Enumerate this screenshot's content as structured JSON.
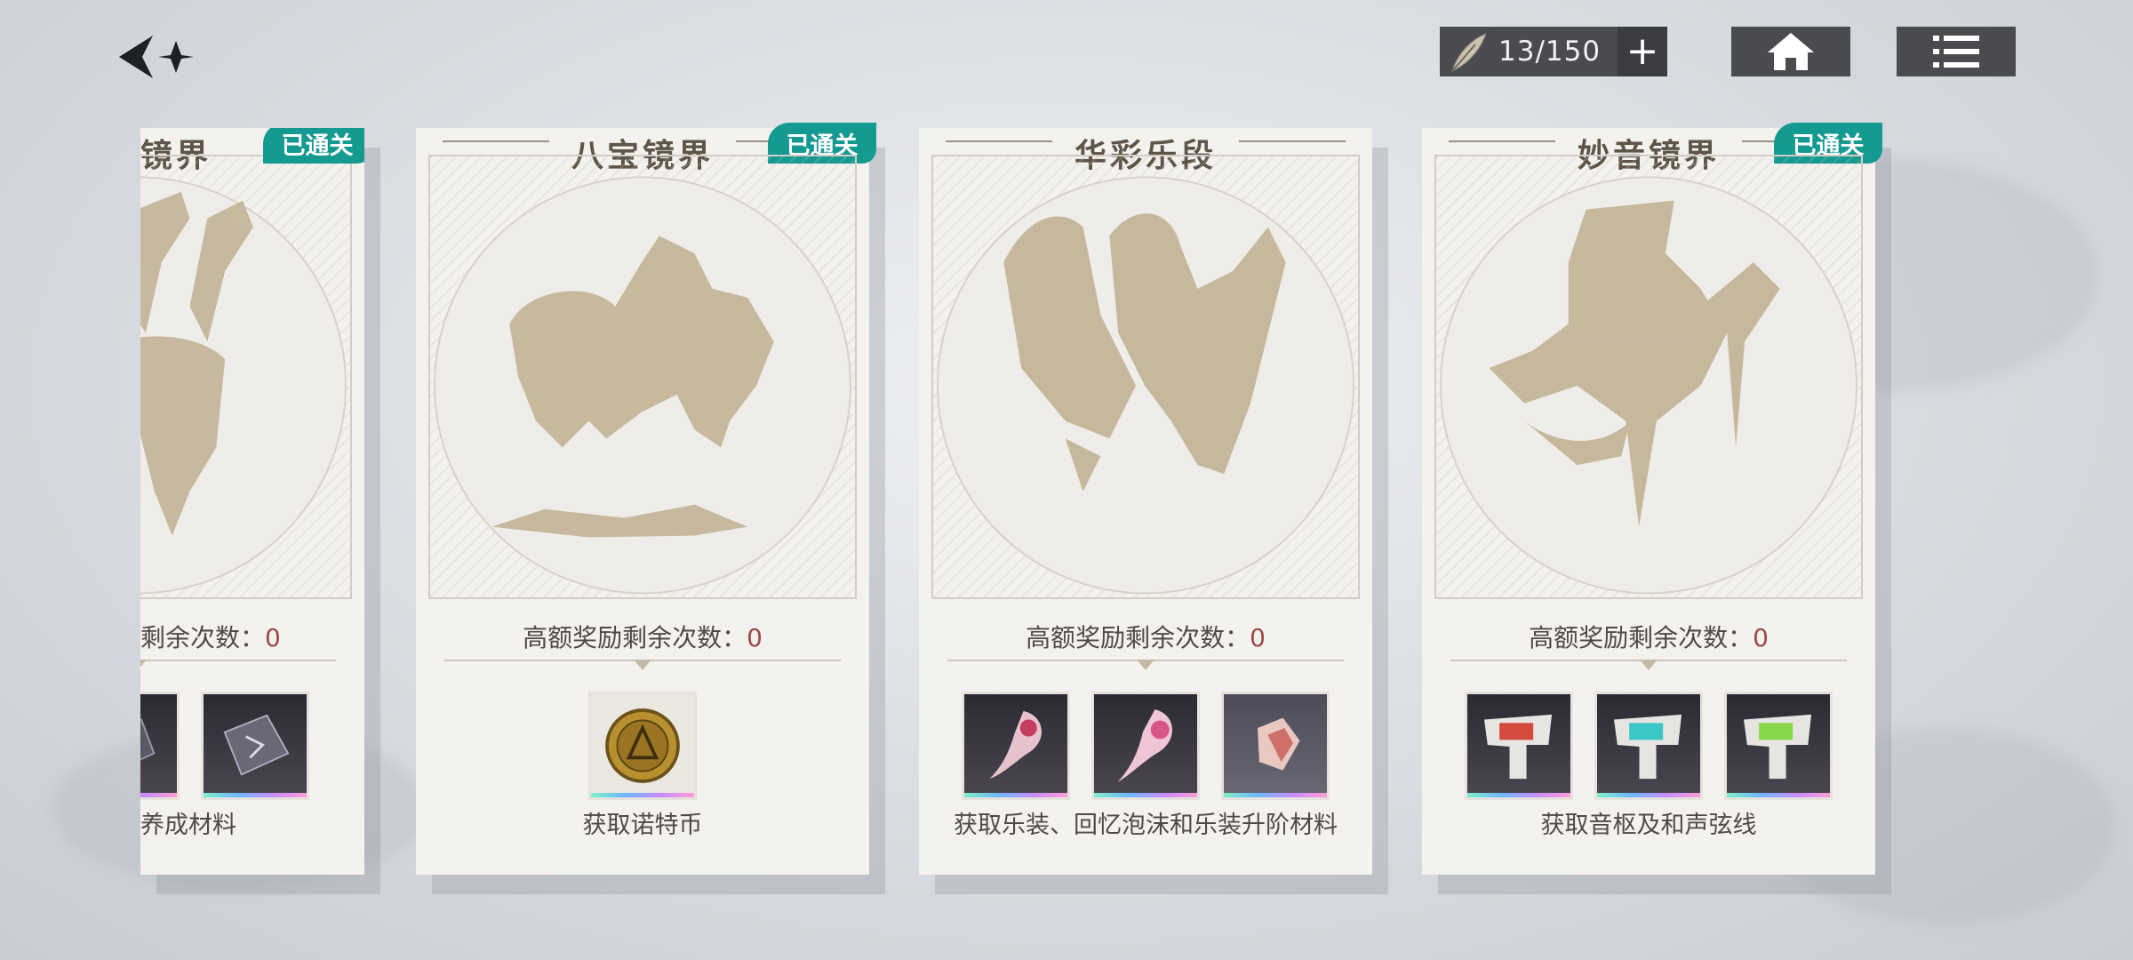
{
  "topbar": {
    "stamina_value": "13/150",
    "plus_label": "+"
  },
  "cards": [
    {
      "title": "镜界",
      "badge": "已通关",
      "remain_label": "剩余次数：",
      "remain_value": "0",
      "desc": "养成材料"
    },
    {
      "title": "八宝镜界",
      "badge": "已通关",
      "remain_label": "高额奖励剩余次数：",
      "remain_value": "0",
      "desc": "获取诺特币"
    },
    {
      "title": "华彩乐段",
      "remain_label": "高额奖励剩余次数：",
      "remain_value": "0",
      "desc": "获取乐装、回忆泡沫和乐装升阶材料"
    },
    {
      "title": "妙音镜界",
      "badge": "已通关",
      "remain_label": "高额奖励剩余次数：",
      "remain_value": "0",
      "desc": "获取音枢及和声弦线"
    }
  ]
}
